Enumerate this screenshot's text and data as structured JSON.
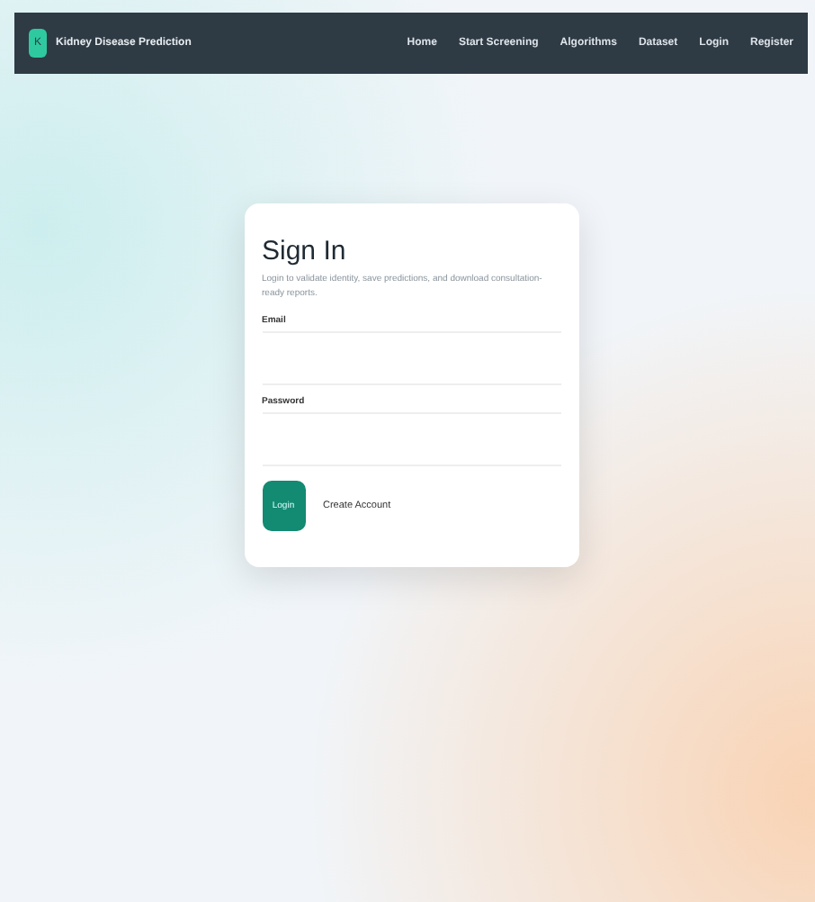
{
  "navbar": {
    "logo_letter": "K",
    "brand": "Kidney Disease Prediction",
    "links": [
      {
        "label": "Home"
      },
      {
        "label": "Start Screening"
      },
      {
        "label": "Algorithms"
      },
      {
        "label": "Dataset"
      },
      {
        "label": "Login"
      },
      {
        "label": "Register"
      }
    ]
  },
  "card": {
    "title": "Sign In",
    "subtitle": "Login to validate identity, save predictions, and download consultation-ready reports.",
    "fields": [
      {
        "label": "Email"
      },
      {
        "label": "Password"
      }
    ],
    "login_button": "Login",
    "create_link": "Create Account"
  }
}
